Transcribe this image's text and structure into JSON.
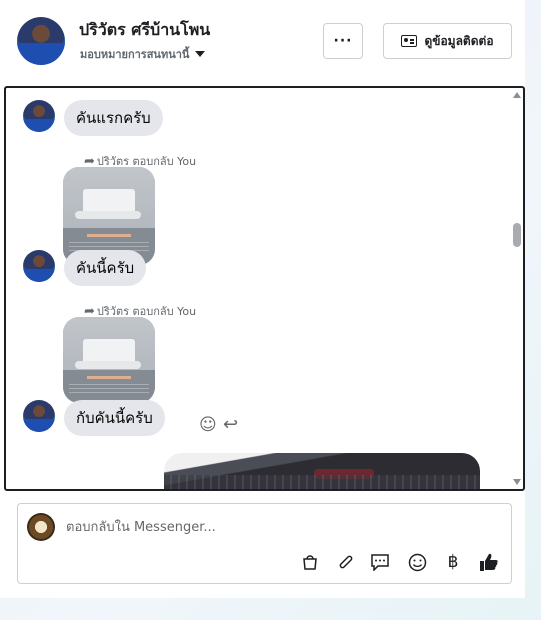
{
  "header": {
    "name": "ปริวัตร ศรีบ้านโพน",
    "assign_label": "มอบหมายการสนทนานี้",
    "more_label": "···",
    "contact_label": "ดูข้อมูลติดต่อ"
  },
  "messages": {
    "m1": "คันแรกครับ",
    "m2_reply_meta": "ปริวัตร ตอบกลับ You",
    "m2": "คันนี้ครับ",
    "m3_reply_meta": "ปริวัตร ตอบกลับ You",
    "m3": "กับคันนี้ครับ"
  },
  "composer": {
    "placeholder": "ตอบกลับใน Messenger..."
  },
  "icons": {
    "reply_arrow": "reply-arrow-icon",
    "emoji": "emoji-icon",
    "reply": "reply-icon",
    "tools": [
      "bag-icon",
      "paperclip-icon",
      "quick-reply-icon",
      "emoji-icon",
      "baht-icon",
      "thumbs-up-icon"
    ]
  }
}
